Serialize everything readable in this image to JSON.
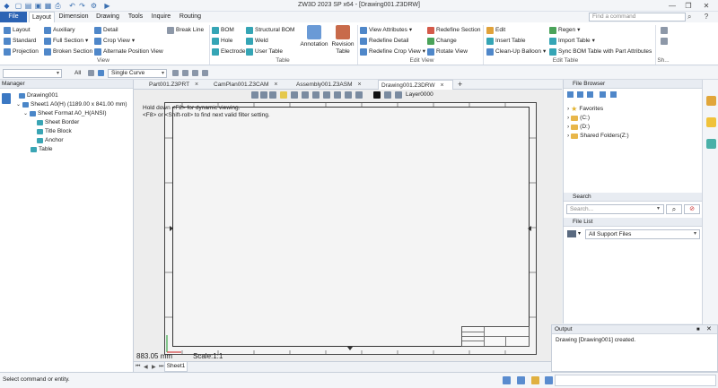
{
  "window": {
    "title": "ZW3D 2023 SP x64 - [Drawing001.Z3DRW]",
    "minimize": "—",
    "restore": "❐",
    "close": "✕",
    "help": "?"
  },
  "menu": {
    "tabs": [
      "File",
      "Layout",
      "Dimension",
      "Drawing",
      "Tools",
      "Inquire",
      "Routing"
    ],
    "active": "Layout",
    "command_search_placeholder": "Find a command"
  },
  "ribbon": {
    "view_group": {
      "label": "View",
      "items": [
        "Layout",
        "Auxiliary",
        "Detail",
        "Break Line",
        "Standard",
        "Full Section",
        "Crop View",
        "Projection",
        "Broken Section",
        "Alternate Position View"
      ]
    },
    "table_group": {
      "label": "Table",
      "items": [
        "BOM",
        "Structural BOM",
        "Hole",
        "Weld",
        "Electrode",
        "User Table",
        "Annotation",
        "Revision Table"
      ]
    },
    "edit_view_group": {
      "label": "Edit View",
      "items": [
        "View Attributes",
        "Redefine Section",
        "Redefine Detail",
        "Change",
        "Redefine Crop View",
        "Rotate View"
      ]
    },
    "edit_table_group": {
      "label": "Edit Table",
      "items": [
        "Edit",
        "Regen",
        "Insert Table",
        "Import Table",
        "Clean-Up Balloon",
        "Sync BOM Table with Part Attributes"
      ]
    },
    "sh_group": {
      "label": "Sh..."
    }
  },
  "filterbar": {
    "filter_value": "",
    "all_label": "All",
    "curve_select": "Single Curve"
  },
  "manager": {
    "title": "Manager",
    "tree": [
      {
        "label": "Drawing001",
        "level": 0,
        "toggle": ""
      },
      {
        "label": "Sheet1 A0(H) (1189.00 x 841.00 mm)",
        "level": 1,
        "toggle": "⌄"
      },
      {
        "label": "Sheet Format A0_H(ANSI)",
        "level": 2,
        "toggle": "⌄"
      },
      {
        "label": "Sheet Border",
        "level": 3,
        "toggle": ""
      },
      {
        "label": "Title Block",
        "level": 3,
        "toggle": ""
      },
      {
        "label": "Anchor",
        "level": 3,
        "toggle": ""
      },
      {
        "label": "Table",
        "level": 2,
        "toggle": ""
      }
    ]
  },
  "doc_tabs": [
    {
      "label": "Part001.Z3PRT",
      "active": false
    },
    {
      "label": "CamPlan001.Z3CAM",
      "active": false
    },
    {
      "label": "Assembly001.Z3ASM",
      "active": false
    },
    {
      "label": "Drawing001.Z3DRW",
      "active": true
    }
  ],
  "doc_tab_add": "+",
  "canvas": {
    "hint_line1": "Hold down <F2> for dynamic viewing.",
    "hint_line2": "<F8> or <Shift-roll> to find next valid filter setting.",
    "layer": "Layer0000",
    "coord_readout": "883.05 mm",
    "scale": "Scale:1:1"
  },
  "sheet_tabs": [
    "Sheet1"
  ],
  "file_browser": {
    "title": "File Browser",
    "items": [
      {
        "label": "Favorites",
        "type": "star"
      },
      {
        "label": "(C:)",
        "type": "folder"
      },
      {
        "label": "(D:)",
        "type": "folder"
      },
      {
        "label": "Shared Folders(Z:)",
        "type": "folder"
      }
    ]
  },
  "search_panel": {
    "title": "Search",
    "placeholder": "Search..."
  },
  "file_list": {
    "title": "File List",
    "filter": "All Support Files"
  },
  "output": {
    "title": "Output",
    "message": "Drawing [Drawing001] created."
  },
  "status": {
    "prompt": "Select command or entity."
  }
}
